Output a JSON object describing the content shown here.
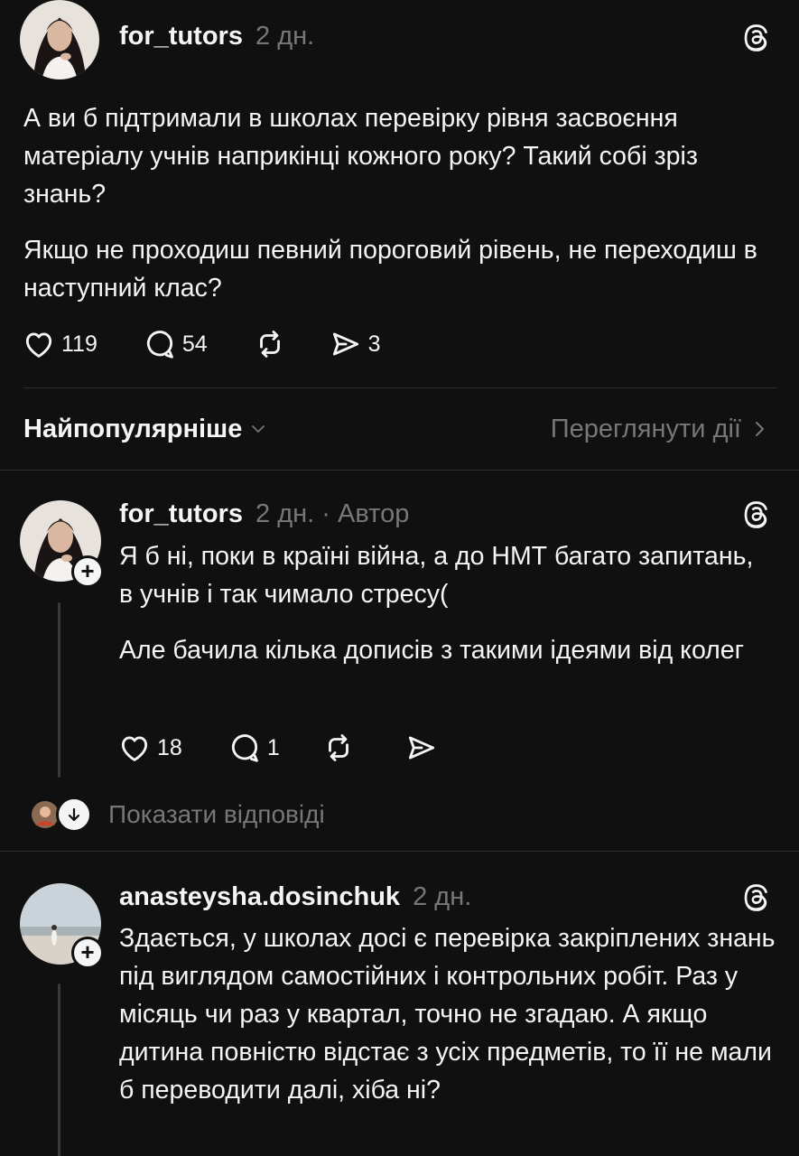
{
  "main_post": {
    "username": "for_tutors",
    "time": "2 дн.",
    "paragraphs": [
      "А ви б підтримали в школах перевірку рівня засвоєння матеріалу учнів наприкінці кожного року? Такий собі зріз знань?",
      "Якщо не проходиш певний пороговий рівень, не переходиш в наступний клас?"
    ],
    "likes": "119",
    "comments": "54",
    "shares": "3"
  },
  "sort_bar": {
    "label": "Найпопулярніше",
    "view_activity": "Переглянути дії"
  },
  "replies": [
    {
      "username": "for_tutors",
      "time": "2 дн.",
      "separator": "·",
      "badge": "Автор",
      "paragraphs": [
        "Я б ні, поки в країні війна, а до НМТ багато запитань, в учнів і так чимало стресу(",
        "Але бачила кілька дописів з такими ідеями від колег"
      ],
      "likes": "18",
      "comments": "1",
      "show_replies": "Показати відповіді"
    },
    {
      "username": "anasteysha.dosinchuk",
      "time": "2 дн.",
      "paragraphs": [
        "Здається, у школах досі є перевірка закріплених знань під виглядом самостійних і контрольних робіт. Раз у місяць чи раз у квартал, точно не згадаю. А якщо дитина повністю відстає з усіх предметів, то її не мали б переводити далі, хіба ні?"
      ]
    }
  ],
  "icons": {
    "like": "heart-icon",
    "comment": "comment-bubble-icon",
    "repost": "repost-icon",
    "share": "send-icon",
    "threads": "threads-logo-icon"
  },
  "colors": {
    "background": "#101010",
    "text": "#f3f5f7",
    "muted": "#777777"
  }
}
